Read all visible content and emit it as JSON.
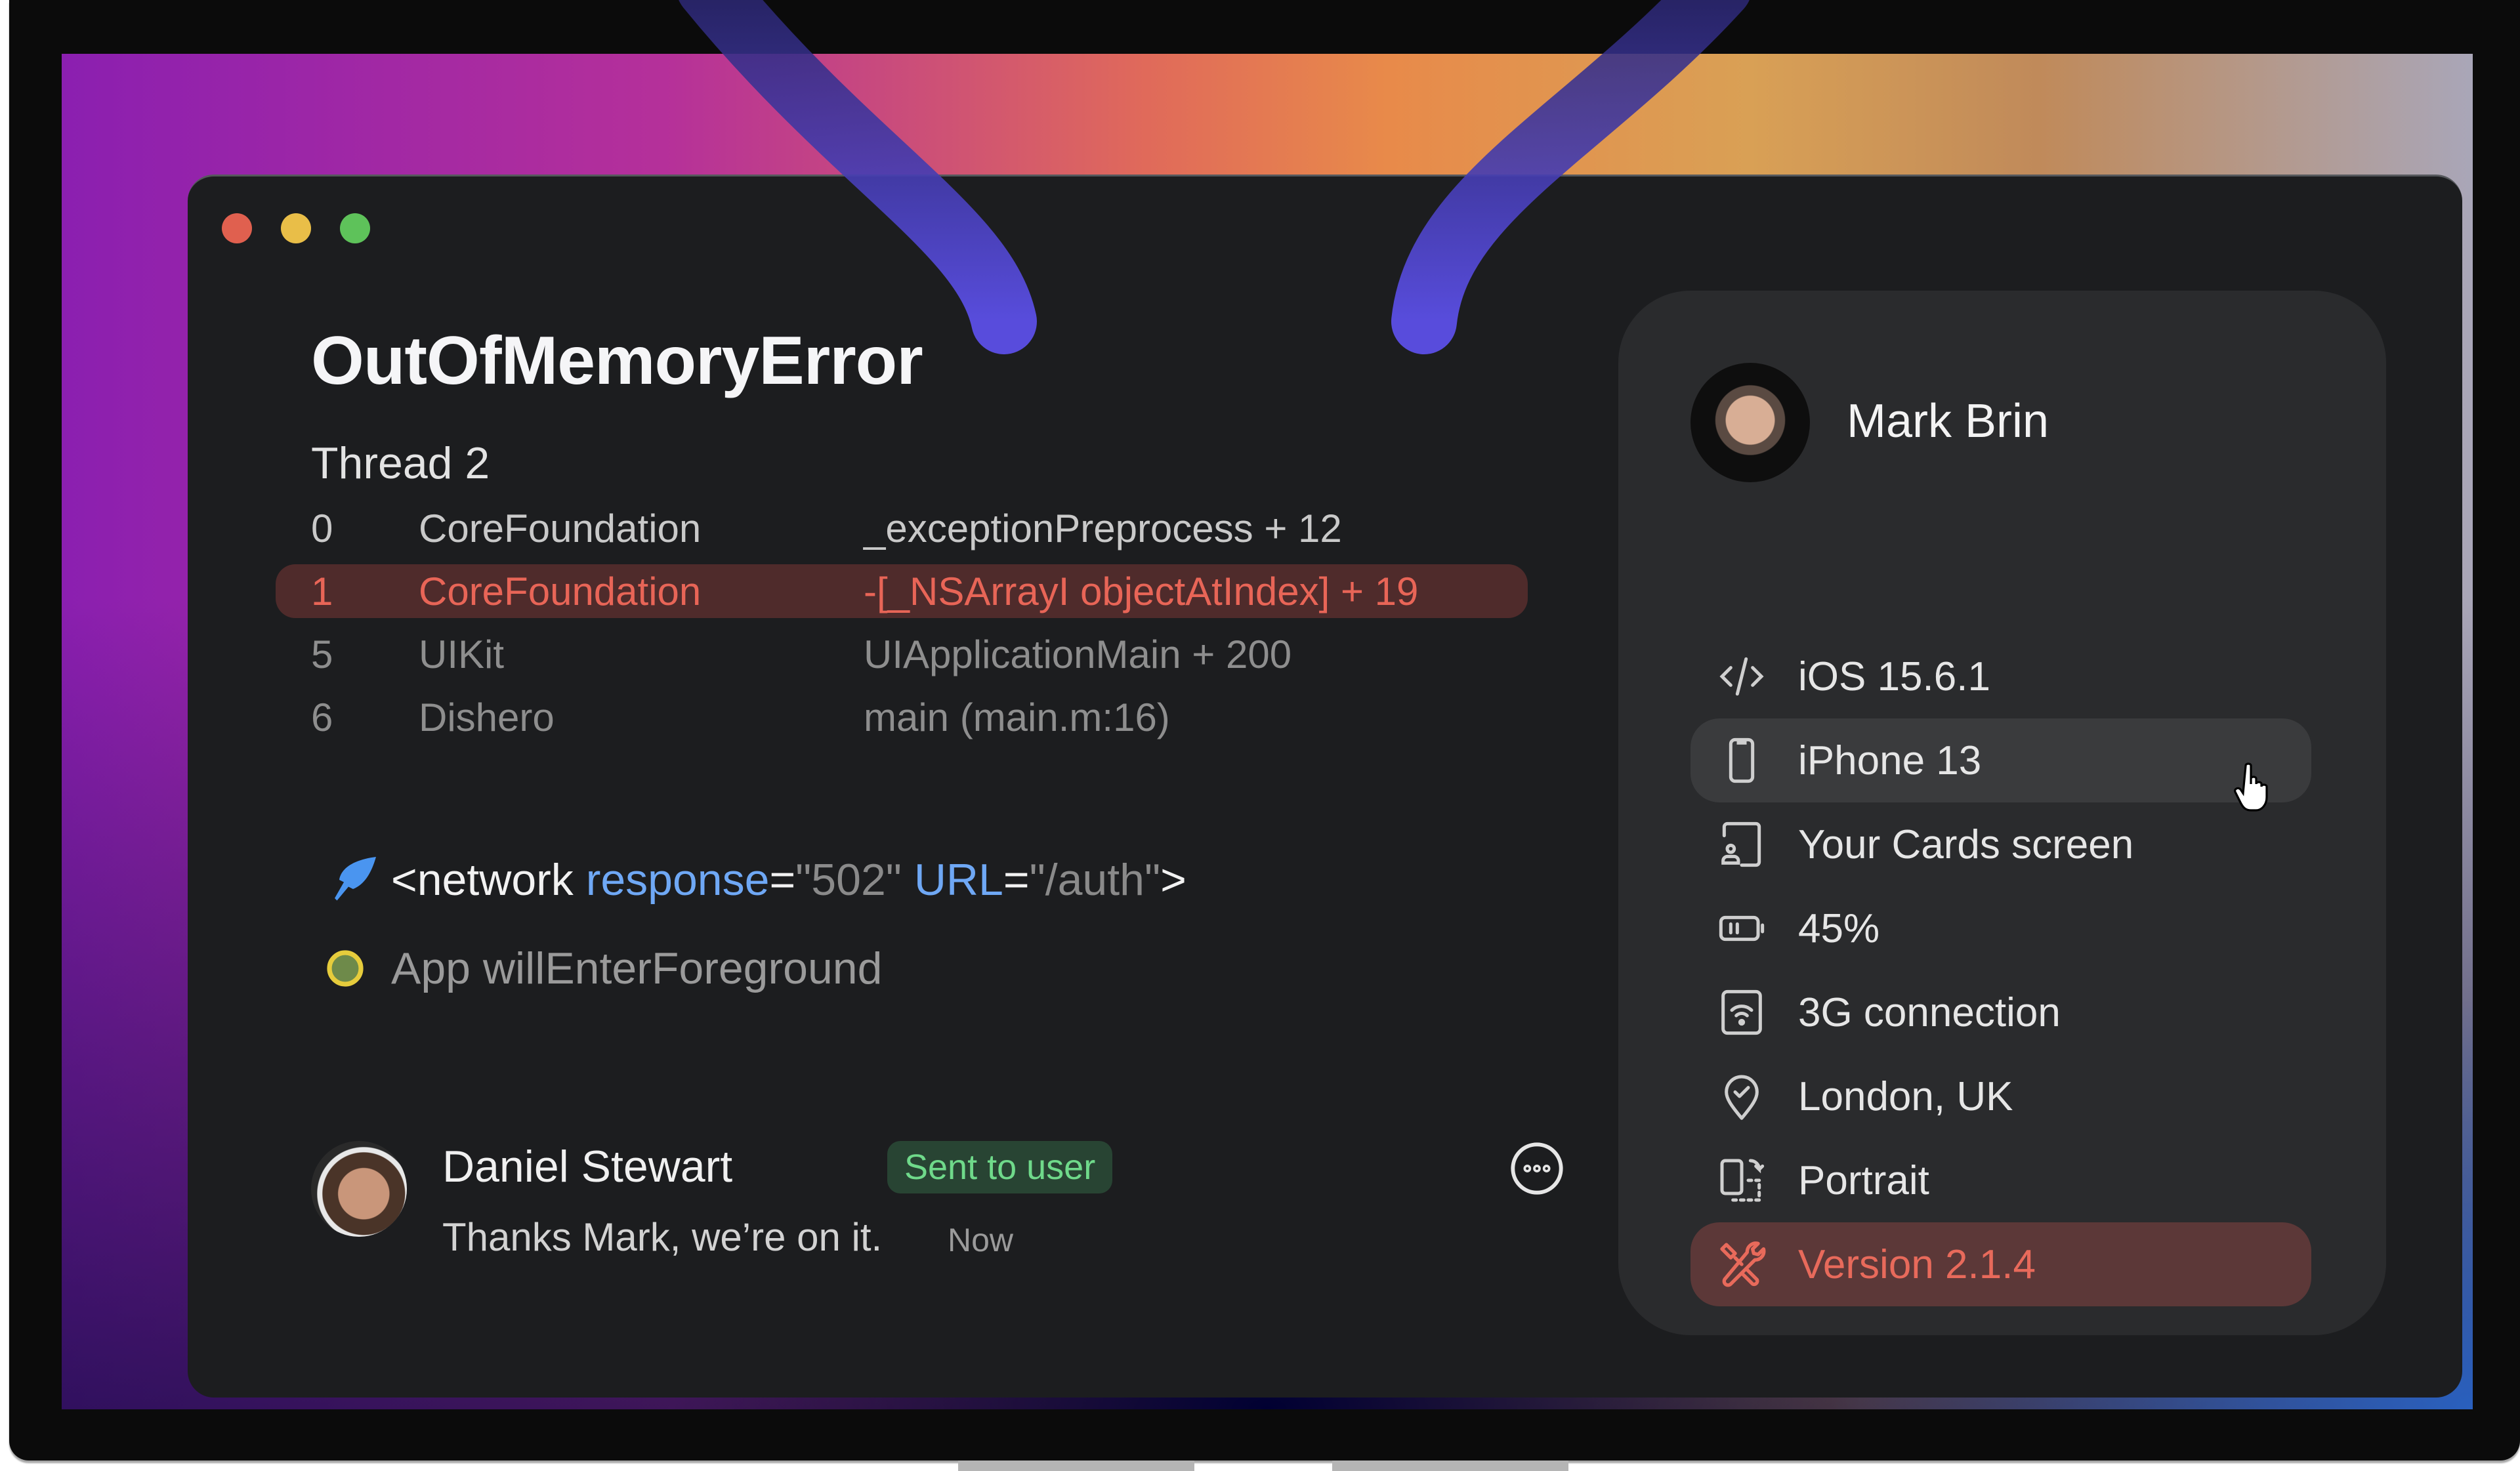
{
  "window": {
    "controls": [
      {
        "name": "close",
        "color": "#e0604f"
      },
      {
        "name": "minimize",
        "color": "#e9be48"
      },
      {
        "name": "maximize",
        "color": "#5ec25a"
      }
    ]
  },
  "error": {
    "title": "OutOfMemoryError",
    "thread": "Thread 2",
    "stack": [
      {
        "index": "0",
        "library": "CoreFoundation",
        "symbol": "_exceptionPreprocess + 12",
        "state": "normal"
      },
      {
        "index": "1",
        "library": "CoreFoundation",
        "symbol": "-[_NSArrayI objectAtIndex] + 19",
        "state": "highlighted"
      },
      {
        "index": "5",
        "library": "UIKit",
        "symbol": "UIApplicationMain + 200",
        "state": "dim"
      },
      {
        "index": "6",
        "library": "Dishero",
        "symbol": "main (main.m:16)",
        "state": "dim"
      }
    ]
  },
  "events": {
    "network": {
      "icon": "feather-icon",
      "open": "<network ",
      "attr1": "response",
      "eq1": "=",
      "val1": "\"502\"",
      "attr2": "URL",
      "eq2": "=",
      "val2": "\"/auth\"",
      "close": ">"
    },
    "app": {
      "icon": "status-dot-icon",
      "text": "App willEnterForeground"
    }
  },
  "comment": {
    "author": "Daniel Stewart",
    "badge": "Sent to user",
    "text": "Thanks Mark, we’re on it.",
    "time": "Now",
    "more_icon": "more-options-icon"
  },
  "user_card": {
    "name": "Mark Brin",
    "details": [
      {
        "icon": "code-icon",
        "label": "iOS 15.6.1"
      },
      {
        "icon": "phone-icon",
        "label": "iPhone 13",
        "state": "hover"
      },
      {
        "icon": "screen-icon",
        "label": "Your Cards screen"
      },
      {
        "icon": "battery-icon",
        "label": "45%"
      },
      {
        "icon": "wifi-icon",
        "label": "3G connection"
      },
      {
        "icon": "location-icon",
        "label": "London, UK"
      },
      {
        "icon": "rotate-icon",
        "label": "Portrait"
      },
      {
        "icon": "tools-icon",
        "label": "Version 2.1.4",
        "state": "error"
      }
    ]
  },
  "colors": {
    "accent_error": "#e86557",
    "accent_attr": "#6fa8f5",
    "badge_green": "#6fd98a",
    "stroke_purple": "#5b4fe6"
  }
}
